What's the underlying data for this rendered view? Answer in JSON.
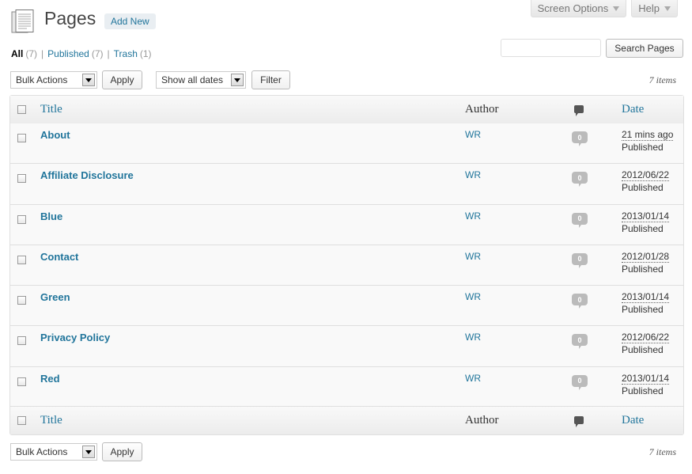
{
  "top_tabs": {
    "screen_options": "Screen Options",
    "help": "Help"
  },
  "header": {
    "title": "Pages",
    "add_new": "Add New"
  },
  "filters": [
    {
      "label": "All",
      "count": "(7)",
      "current": true
    },
    {
      "label": "Published",
      "count": "(7)",
      "current": false
    },
    {
      "label": "Trash",
      "count": "(1)",
      "current": false
    }
  ],
  "search": {
    "value": "",
    "button": "Search Pages"
  },
  "tablenav_top": {
    "bulk_actions": "Bulk Actions",
    "apply": "Apply",
    "dates": "Show all dates",
    "filter": "Filter",
    "items": "7 items"
  },
  "tablenav_bottom": {
    "bulk_actions": "Bulk Actions",
    "apply": "Apply",
    "items": "7 items"
  },
  "columns": {
    "title": "Title",
    "author": "Author",
    "date": "Date"
  },
  "rows": [
    {
      "title": "About",
      "author": "WR",
      "comments": "0",
      "date": "21 mins ago",
      "status": "Published"
    },
    {
      "title": "Affiliate Disclosure",
      "author": "WR",
      "comments": "0",
      "date": "2012/06/22",
      "status": "Published"
    },
    {
      "title": "Blue",
      "author": "WR",
      "comments": "0",
      "date": "2013/01/14",
      "status": "Published"
    },
    {
      "title": "Contact",
      "author": "WR",
      "comments": "0",
      "date": "2012/01/28",
      "status": "Published"
    },
    {
      "title": "Green",
      "author": "WR",
      "comments": "0",
      "date": "2013/01/14",
      "status": "Published"
    },
    {
      "title": "Privacy Policy",
      "author": "WR",
      "comments": "0",
      "date": "2012/06/22",
      "status": "Published"
    },
    {
      "title": "Red",
      "author": "WR",
      "comments": "0",
      "date": "2013/01/14",
      "status": "Published"
    }
  ]
}
